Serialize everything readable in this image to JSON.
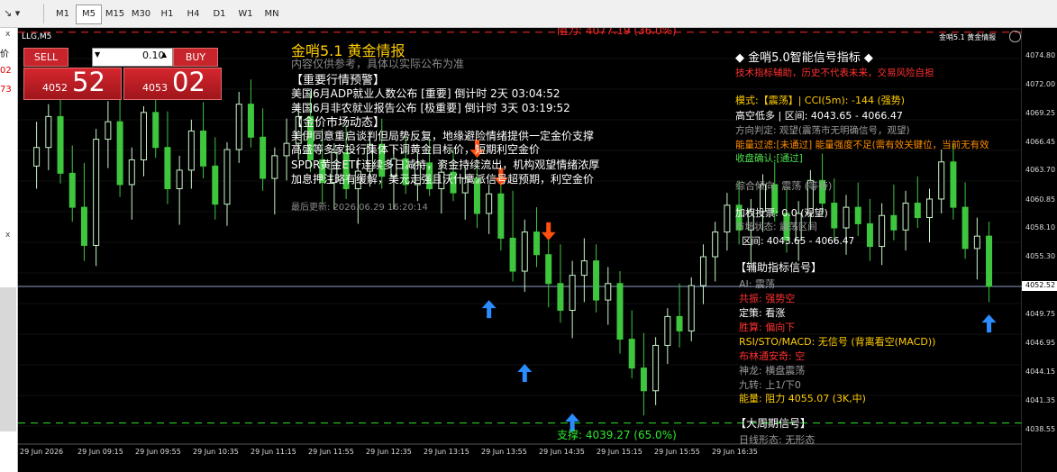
{
  "toolbar": {
    "tool_label": "↘ ▾",
    "timeframes": [
      "M1",
      "M5",
      "M15",
      "M30",
      "H1",
      "H4",
      "D1",
      "W1",
      "MN"
    ],
    "active_timeframe": "M5"
  },
  "left_strip": {
    "t1": "价",
    "t2": "02",
    "t3": "73",
    "t4": "x",
    "t5": "x"
  },
  "chart": {
    "symbol_label": "LLG,M5",
    "corner_title": "金哨5.1 黄金情报",
    "resistance_label": "阻力: 4077.19 (36.0%)",
    "support_label": "支撑: 4039.27 (65.0%)",
    "current_price": "4052.52",
    "y_ticks": [
      "4074.80",
      "4072.00",
      "4069.25",
      "4066.45",
      "4063.70",
      "4060.85",
      "4058.10",
      "4055.30",
      "4052.52",
      "4049.75",
      "4046.95",
      "4044.15",
      "4041.35",
      "4038.55"
    ],
    "x_ticks": [
      "29 Jun 2026",
      "29 Jun 09:15",
      "29 Jun 09:55",
      "29 Jun 10:35",
      "29 Jun 11:15",
      "29 Jun 11:55",
      "29 Jun 12:35",
      "29 Jun 13:15",
      "29 Jun 13:55",
      "29 Jun 14:35",
      "29 Jun 15:15",
      "29 Jun 15:55",
      "29 Jun 16:35"
    ]
  },
  "trade": {
    "sell_label": "SELL",
    "buy_label": "BUY",
    "lot_value": "0.10",
    "sell_price_small": "4052",
    "sell_price_big": "52",
    "buy_price_small": "4053",
    "buy_price_big": "02"
  },
  "news": {
    "title": "金哨5.1 黄金情报",
    "subtitle": "内容仅供参考，具体以实际公布为准",
    "section1": "【重要行情预警】",
    "line1": "美国6月ADP就业人数公布 [重要] 倒计时 2天 03:04:52",
    "line2": "美国6月非农就业报告公布 [极重要] 倒计时 3天 03:19:52",
    "section2": "【金价市场动态】",
    "line3": "美伊同意重启谈判但局势反复，地缘避险情绪提供一定金价支撑",
    "line4": "高盛等多家投行集体下调黄金目标价，短期利空金价",
    "line5": "SPDR黄金ETF连续多日减持，资金持续流出，机构观望情绪浓厚",
    "line6": "加息押注略有缓解，美元走强且沃什鹰派信号超预期，利空金价",
    "updated": "最后更新: 2026.06.29 16:20:14"
  },
  "signal": {
    "title": "◆ 金哨5.0智能信号指标 ◆",
    "warning": "技术指标辅助，历史不代表未来，交易风险自担",
    "mode": "模式:【震荡】| CCI(5m): -144 (强势)",
    "range": "高空低多 | 区间: 4043.65 - 4066.47",
    "direction": "方向判定: 观望(震荡市无明确信号，观望)",
    "energy_filter": "能量过滤:[未通过] 能量强度不足(需有效关键位，当前无有效",
    "close_confirm": "收盘确认:[通过]",
    "overall": "综合倾向: 震荡 (等待)",
    "vote": "加权投票: 0.0 (观望)",
    "market_state": "市场状态: 震荡区间",
    "range2": "区间: 4043.65 - 4066.47",
    "aux_title": "【辅助指标信号】",
    "ai": "AI: 震荡",
    "gongzhen": "共振: 强势空",
    "dingce": "定策: 看涨",
    "shenglin": "胜算: 偏向下",
    "rsi": "RSI/STO/MACD: 无信号 (背离看空(MACD))",
    "boll": "布林通安奇: 空",
    "shenlong": "神龙: 横盘震荡",
    "jiuzhuan": "九转: 上1/下0",
    "energy": "能量: 阻力 4055.07 (3K,中)",
    "big_title": "【大周期信号】",
    "big_line": "日线形态: 无形态"
  },
  "colors": {
    "up": "#c8f5c8",
    "down": "#3ec63e",
    "grid": "#1a1a1a",
    "accent": "#ffcc00",
    "red": "#ff3030",
    "sell_arrow": "#ff5010",
    "buy_arrow": "#2a8cff"
  },
  "chart_data": {
    "type": "candlestick",
    "series": [
      {
        "o": 4064.2,
        "h": 4068.5,
        "l": 4062.0,
        "c": 4066.0
      },
      {
        "o": 4066.0,
        "h": 4070.2,
        "l": 4063.8,
        "c": 4069.0
      },
      {
        "o": 4069.0,
        "h": 4071.0,
        "l": 4062.5,
        "c": 4063.5
      },
      {
        "o": 4063.5,
        "h": 4066.2,
        "l": 4058.8,
        "c": 4060.2
      },
      {
        "o": 4060.2,
        "h": 4064.5,
        "l": 4055.0,
        "c": 4056.5
      },
      {
        "o": 4056.5,
        "h": 4067.8,
        "l": 4054.5,
        "c": 4066.8
      },
      {
        "o": 4066.8,
        "h": 4070.5,
        "l": 4064.0,
        "c": 4068.5
      },
      {
        "o": 4068.5,
        "h": 4071.3,
        "l": 4061.2,
        "c": 4062.4
      },
      {
        "o": 4062.4,
        "h": 4066.0,
        "l": 4059.0,
        "c": 4064.8
      },
      {
        "o": 4064.8,
        "h": 4070.0,
        "l": 4063.2,
        "c": 4069.4
      },
      {
        "o": 4069.4,
        "h": 4072.0,
        "l": 4065.0,
        "c": 4066.0
      },
      {
        "o": 4066.0,
        "h": 4069.5,
        "l": 4060.5,
        "c": 4062.0
      },
      {
        "o": 4062.0,
        "h": 4065.2,
        "l": 4058.5,
        "c": 4063.8
      },
      {
        "o": 4063.8,
        "h": 4068.7,
        "l": 4062.0,
        "c": 4067.6
      },
      {
        "o": 4067.6,
        "h": 4070.4,
        "l": 4063.0,
        "c": 4064.2
      },
      {
        "o": 4064.2,
        "h": 4067.0,
        "l": 4059.0,
        "c": 4060.5
      },
      {
        "o": 4060.5,
        "h": 4066.5,
        "l": 4058.4,
        "c": 4065.8
      },
      {
        "o": 4065.8,
        "h": 4071.4,
        "l": 4064.5,
        "c": 4070.2
      },
      {
        "o": 4070.2,
        "h": 4072.6,
        "l": 4066.0,
        "c": 4067.0
      },
      {
        "o": 4067.0,
        "h": 4069.8,
        "l": 4061.8,
        "c": 4063.0
      },
      {
        "o": 4063.0,
        "h": 4066.0,
        "l": 4059.5,
        "c": 4065.2
      },
      {
        "o": 4065.2,
        "h": 4068.8,
        "l": 4062.8,
        "c": 4066.4
      },
      {
        "o": 4066.4,
        "h": 4070.2,
        "l": 4064.8,
        "c": 4069.0
      },
      {
        "o": 4069.0,
        "h": 4071.5,
        "l": 4063.6,
        "c": 4064.8
      },
      {
        "o": 4064.8,
        "h": 4067.8,
        "l": 4060.5,
        "c": 4062.6
      },
      {
        "o": 4062.6,
        "h": 4066.4,
        "l": 4060.0,
        "c": 4065.5
      },
      {
        "o": 4065.5,
        "h": 4068.2,
        "l": 4061.0,
        "c": 4062.0
      },
      {
        "o": 4062.0,
        "h": 4065.0,
        "l": 4058.6,
        "c": 4063.7
      },
      {
        "o": 4063.7,
        "h": 4067.5,
        "l": 4062.2,
        "c": 4066.3
      },
      {
        "o": 4066.3,
        "h": 4068.8,
        "l": 4062.0,
        "c": 4063.2
      },
      {
        "o": 4063.2,
        "h": 4066.1,
        "l": 4060.0,
        "c": 4064.9
      },
      {
        "o": 4064.9,
        "h": 4067.2,
        "l": 4061.5,
        "c": 4062.4
      },
      {
        "o": 4062.4,
        "h": 4065.6,
        "l": 4060.8,
        "c": 4064.5
      },
      {
        "o": 4064.5,
        "h": 4066.9,
        "l": 4061.3,
        "c": 4062.0
      },
      {
        "o": 4062.0,
        "h": 4064.8,
        "l": 4059.6,
        "c": 4063.6
      },
      {
        "o": 4063.6,
        "h": 4065.8,
        "l": 4060.8,
        "c": 4061.6
      },
      {
        "o": 4061.6,
        "h": 4064.2,
        "l": 4059.0,
        "c": 4063.0
      },
      {
        "o": 4063.0,
        "h": 4064.6,
        "l": 4058.2,
        "c": 4059.6
      },
      {
        "o": 4059.6,
        "h": 4062.4,
        "l": 4057.6,
        "c": 4061.5
      },
      {
        "o": 4061.5,
        "h": 4063.0,
        "l": 4056.0,
        "c": 4057.2
      },
      {
        "o": 4057.2,
        "h": 4061.8,
        "l": 4053.0,
        "c": 4054.0
      },
      {
        "o": 4054.0,
        "h": 4059.0,
        "l": 4052.0,
        "c": 4057.8
      },
      {
        "o": 4057.8,
        "h": 4060.2,
        "l": 4054.4,
        "c": 4055.6
      },
      {
        "o": 4055.6,
        "h": 4058.4,
        "l": 4050.5,
        "c": 4052.8
      },
      {
        "o": 4052.8,
        "h": 4056.6,
        "l": 4049.0,
        "c": 4050.2
      },
      {
        "o": 4050.2,
        "h": 4055.0,
        "l": 4047.5,
        "c": 4053.6
      },
      {
        "o": 4053.6,
        "h": 4057.2,
        "l": 4051.0,
        "c": 4055.0
      },
      {
        "o": 4055.0,
        "h": 4056.6,
        "l": 4050.0,
        "c": 4051.2
      },
      {
        "o": 4051.2,
        "h": 4054.4,
        "l": 4048.8,
        "c": 4052.8
      },
      {
        "o": 4052.8,
        "h": 4054.0,
        "l": 4046.0,
        "c": 4047.4
      },
      {
        "o": 4047.4,
        "h": 4050.2,
        "l": 4043.6,
        "c": 4044.6
      },
      {
        "o": 4044.6,
        "h": 4048.0,
        "l": 4040.0,
        "c": 4042.4
      },
      {
        "o": 4042.4,
        "h": 4047.6,
        "l": 4041.0,
        "c": 4046.8
      },
      {
        "o": 4046.8,
        "h": 4050.4,
        "l": 4045.0,
        "c": 4049.6
      },
      {
        "o": 4049.6,
        "h": 4052.8,
        "l": 4046.6,
        "c": 4048.2
      },
      {
        "o": 4048.2,
        "h": 4053.4,
        "l": 4047.2,
        "c": 4052.6
      },
      {
        "o": 4052.6,
        "h": 4056.6,
        "l": 4050.8,
        "c": 4055.4
      },
      {
        "o": 4055.4,
        "h": 4058.8,
        "l": 4053.0,
        "c": 4057.8
      },
      {
        "o": 4057.8,
        "h": 4061.6,
        "l": 4056.0,
        "c": 4060.4
      },
      {
        "o": 4060.4,
        "h": 4062.8,
        "l": 4056.6,
        "c": 4058.0
      },
      {
        "o": 4058.0,
        "h": 4061.0,
        "l": 4054.4,
        "c": 4059.8
      },
      {
        "o": 4059.8,
        "h": 4063.4,
        "l": 4057.8,
        "c": 4062.4
      },
      {
        "o": 4062.4,
        "h": 4064.6,
        "l": 4058.8,
        "c": 4059.6
      },
      {
        "o": 4059.6,
        "h": 4062.0,
        "l": 4055.8,
        "c": 4057.0
      },
      {
        "o": 4057.0,
        "h": 4060.8,
        "l": 4055.0,
        "c": 4059.6
      },
      {
        "o": 4059.6,
        "h": 4063.8,
        "l": 4058.0,
        "c": 4062.8
      },
      {
        "o": 4062.8,
        "h": 4065.4,
        "l": 4059.4,
        "c": 4060.6
      },
      {
        "o": 4060.6,
        "h": 4063.0,
        "l": 4057.0,
        "c": 4058.2
      },
      {
        "o": 4058.2,
        "h": 4061.4,
        "l": 4055.6,
        "c": 4060.2
      },
      {
        "o": 4060.2,
        "h": 4062.6,
        "l": 4057.4,
        "c": 4058.6
      },
      {
        "o": 4058.6,
        "h": 4061.0,
        "l": 4055.0,
        "c": 4056.4
      },
      {
        "o": 4056.4,
        "h": 4060.6,
        "l": 4054.6,
        "c": 4059.4
      },
      {
        "o": 4059.4,
        "h": 4062.4,
        "l": 4057.0,
        "c": 4058.0
      },
      {
        "o": 4058.0,
        "h": 4061.8,
        "l": 4056.0,
        "c": 4060.6
      },
      {
        "o": 4060.6,
        "h": 4063.2,
        "l": 4058.2,
        "c": 4059.2
      },
      {
        "o": 4059.2,
        "h": 4062.0,
        "l": 4056.8,
        "c": 4061.0
      },
      {
        "o": 4061.0,
        "h": 4065.8,
        "l": 4059.6,
        "c": 4064.6
      },
      {
        "o": 4064.6,
        "h": 4066.4,
        "l": 4059.0,
        "c": 4060.2
      },
      {
        "o": 4060.2,
        "h": 4062.6,
        "l": 4055.2,
        "c": 4056.2
      },
      {
        "o": 4056.2,
        "h": 4059.2,
        "l": 4053.2,
        "c": 4057.4
      },
      {
        "o": 4057.4,
        "h": 4058.8,
        "l": 4051.0,
        "c": 4052.52
      }
    ]
  }
}
